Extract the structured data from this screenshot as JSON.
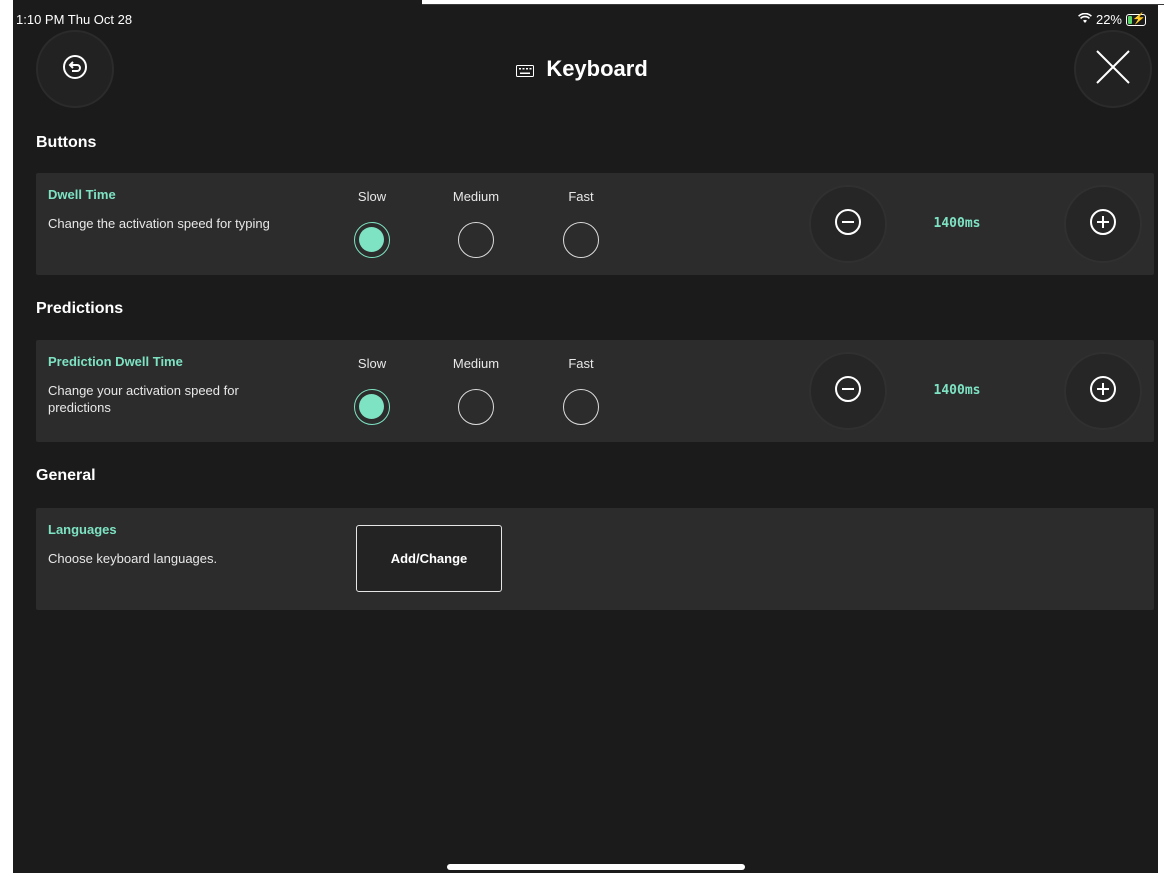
{
  "status_bar": {
    "time": "1:10 PM  Thu Oct 28",
    "battery": "22%"
  },
  "header": {
    "title": "Keyboard"
  },
  "sections": {
    "buttons": {
      "heading": "Buttons",
      "setting": {
        "title": "Dwell Time",
        "description": "Change the activation speed for typing",
        "options": [
          "Slow",
          "Medium",
          "Fast"
        ],
        "selected": "Slow",
        "value": "1400ms"
      }
    },
    "predictions": {
      "heading": "Predictions",
      "setting": {
        "title": "Prediction Dwell Time",
        "description": "Change your activation speed for predictions",
        "options": [
          "Slow",
          "Medium",
          "Fast"
        ],
        "selected": "Slow",
        "value": "1400ms"
      }
    },
    "general": {
      "heading": "General",
      "setting": {
        "title": "Languages",
        "description": "Choose keyboard languages.",
        "button_label": "Add/Change"
      }
    }
  },
  "colors": {
    "accent": "#7de3c3",
    "background": "#1b1b1b",
    "card": "#2c2c2c"
  },
  "icons": [
    "back-icon",
    "close-icon",
    "keyboard-icon",
    "minus-icon",
    "plus-icon",
    "wifi-icon",
    "battery-icon"
  ]
}
